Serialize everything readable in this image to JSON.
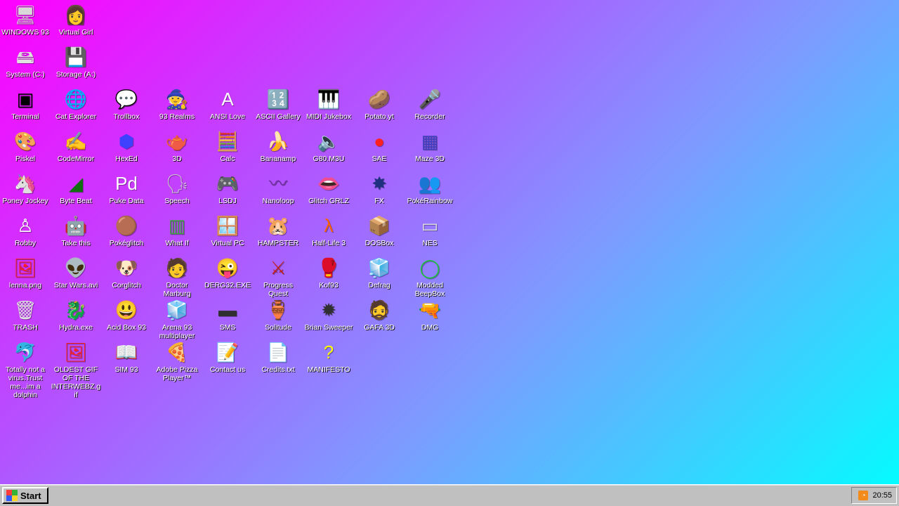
{
  "desktop": {
    "icons": [
      {
        "label": "WINDOWS 93",
        "name": "windows93",
        "glyph": "🖥",
        "color": "#d8d8d8"
      },
      {
        "label": "Virtual Girl",
        "name": "virtual-girl",
        "glyph": "👩",
        "color": "#e0b090"
      },
      {
        "label": "System (C:)",
        "name": "system-c",
        "glyph": "🖴",
        "color": "#e0e0e0"
      },
      {
        "label": "Storage (A:)",
        "name": "storage-a",
        "glyph": "💾",
        "color": "#d0d0d0"
      },
      {
        "label": "Terminal",
        "name": "terminal",
        "glyph": "▣",
        "color": "#000000"
      },
      {
        "label": "Cat Explorer",
        "name": "cat-explorer",
        "glyph": "🌐",
        "color": "#3c9cff"
      },
      {
        "label": "Trollbox",
        "name": "trollbox",
        "glyph": "💬",
        "color": "#4cc9ff"
      },
      {
        "label": "93 Realms",
        "name": "93-realms",
        "glyph": "🧙",
        "color": "#ff2020"
      },
      {
        "label": "ANSI Love",
        "name": "ansi-love",
        "glyph": "A",
        "color": "#ffffff"
      },
      {
        "label": "ASCII Gallery",
        "name": "ascii-gallery",
        "glyph": "🔢",
        "color": "#00b0b0"
      },
      {
        "label": "MIDI Jukebox",
        "name": "midi-jukebox",
        "glyph": "🎹",
        "color": "#222222"
      },
      {
        "label": "Potato.yt",
        "name": "potato-yt",
        "glyph": "🥔",
        "color": "#c08040"
      },
      {
        "label": "Recorder",
        "name": "recorder",
        "glyph": "🎤",
        "color": "#888888"
      },
      {
        "label": "Piskel",
        "name": "piskel",
        "glyph": "🎨",
        "color": "#e0b020"
      },
      {
        "label": "CodeMirror",
        "name": "codemirror",
        "glyph": "✍",
        "color": "#ffffff"
      },
      {
        "label": "HexEd",
        "name": "hexed",
        "glyph": "⬢",
        "color": "#4040ff"
      },
      {
        "label": "3D",
        "name": "3d",
        "glyph": "🫖",
        "color": "#ff9ec4"
      },
      {
        "label": "Calc",
        "name": "calc",
        "glyph": "🧮",
        "color": "#2a7ad8"
      },
      {
        "label": "Bananamp",
        "name": "bananamp",
        "glyph": "🍌",
        "color": "#ffe000"
      },
      {
        "label": "G80.M3U",
        "name": "g80-m3u",
        "glyph": "🔈",
        "color": "#ffffff"
      },
      {
        "label": "SAE",
        "name": "sae",
        "glyph": "●",
        "color": "#ff2020"
      },
      {
        "label": "Maze 3D",
        "name": "maze-3d",
        "glyph": "▦",
        "color": "#4040c0"
      },
      {
        "label": "Poney Jockey",
        "name": "poney-jockey",
        "glyph": "🦄",
        "color": "#c080ff"
      },
      {
        "label": "Byte Beat",
        "name": "byte-beat",
        "glyph": "◢",
        "color": "#107010"
      },
      {
        "label": "Puke Data",
        "name": "puke-data",
        "glyph": "Pd",
        "color": "#ffffff"
      },
      {
        "label": "Speech",
        "name": "speech",
        "glyph": "🗣",
        "color": "#d0d0d0"
      },
      {
        "label": "LSDJ",
        "name": "lsdj",
        "glyph": "🎮",
        "color": "#ff40ff"
      },
      {
        "label": "Nanoloop",
        "name": "nanoloop",
        "glyph": "〰",
        "color": "#7030a0"
      },
      {
        "label": "Glitch GRLZ",
        "name": "glitch-grlz",
        "glyph": "👄",
        "color": "#ff2050"
      },
      {
        "label": "FX",
        "name": "fx",
        "glyph": "✸",
        "color": "#203080"
      },
      {
        "label": "PokéRainbow",
        "name": "pokerainbow",
        "glyph": "👥",
        "color": "#604020"
      },
      {
        "label": "Robby",
        "name": "robby",
        "glyph": "♙",
        "color": "#ffffff"
      },
      {
        "label": "Take this",
        "name": "take-this",
        "glyph": "🤖",
        "color": "#ff6020"
      },
      {
        "label": "Pokéglitch",
        "name": "pokeglitch",
        "glyph": "🟤",
        "color": "#a06030"
      },
      {
        "label": "What If",
        "name": "what-if",
        "glyph": "▥",
        "color": "#40a040"
      },
      {
        "label": "Virtual PC",
        "name": "virtual-pc",
        "glyph": "🪟",
        "color": "#2060c0"
      },
      {
        "label": "HAMPSTER",
        "name": "hampster",
        "glyph": "🐹",
        "color": "#ffffff"
      },
      {
        "label": "Half-Life 3",
        "name": "half-life-3",
        "glyph": "λ",
        "color": "#ff6000"
      },
      {
        "label": "DOSBox",
        "name": "dosbox",
        "glyph": "📦",
        "color": "#c0a000"
      },
      {
        "label": "NES",
        "name": "nes",
        "glyph": "▭",
        "color": "#e0e0e0"
      },
      {
        "label": "lenna.png",
        "name": "lenna-png",
        "glyph": "🖼",
        "color": "#ff2020"
      },
      {
        "label": "Star Wars.avi",
        "name": "star-wars-avi",
        "glyph": "👽",
        "color": "#60c040"
      },
      {
        "label": "Corglitch",
        "name": "corglitch",
        "glyph": "🐶",
        "color": "#d08030"
      },
      {
        "label": "Doctor Marburg",
        "name": "doctor-marburg",
        "glyph": "🧑",
        "color": "#e0c0a0"
      },
      {
        "label": "DERG32.EXE",
        "name": "derg32-exe",
        "glyph": "😜",
        "color": "#ffffff"
      },
      {
        "label": "Progress Quest",
        "name": "progress-quest",
        "glyph": "⚔",
        "color": "#c02020"
      },
      {
        "label": "Kof93",
        "name": "kof93",
        "glyph": "🥊",
        "color": "#d0a080"
      },
      {
        "label": "Defrag",
        "name": "defrag",
        "glyph": "🧊",
        "color": "#3080ff"
      },
      {
        "label": "Modded BeepBox",
        "name": "modded-beepbox",
        "glyph": "◯",
        "color": "#20c040"
      },
      {
        "label": "TRASH",
        "name": "trash",
        "glyph": "🗑",
        "color": "#e0e0e0"
      },
      {
        "label": "Hydra.exe",
        "name": "hydra-exe",
        "glyph": "🐉",
        "color": "#208020"
      },
      {
        "label": "Acid Box 93",
        "name": "acid-box-93",
        "glyph": "😃",
        "color": "#ffff00"
      },
      {
        "label": "Arena 93 multiplayer",
        "name": "arena-93-multiplayer",
        "glyph": "🧊",
        "color": "#40c0ff"
      },
      {
        "label": "SMS",
        "name": "sms",
        "glyph": "▬",
        "color": "#303030"
      },
      {
        "label": "Solitude",
        "name": "solitude",
        "glyph": "🏺",
        "color": "#40a0ff"
      },
      {
        "label": "Brian Sweeper",
        "name": "brian-sweeper",
        "glyph": "✹",
        "color": "#303030"
      },
      {
        "label": "GAFA 3D",
        "name": "gafa-3d",
        "glyph": "🧔",
        "color": "#c07030"
      },
      {
        "label": "DMG",
        "name": "dmg",
        "glyph": "🔫",
        "color": "#a0a0a0"
      },
      {
        "label": "Totally not a virus.Trust me...im a dolphin",
        "name": "dolphin",
        "glyph": "🐬",
        "color": "#40a0ff"
      },
      {
        "label": "OLDEST GIF OF THE INTERWEBZ.gif",
        "name": "oldest-gif",
        "glyph": "🖼",
        "color": "#ff2020"
      },
      {
        "label": "SIM 93",
        "name": "sim-93",
        "glyph": "📖",
        "color": "#ffffff"
      },
      {
        "label": "Adobe Pizza Player™",
        "name": "adobe-pizza-player",
        "glyph": "🍕",
        "color": "#e0a040"
      },
      {
        "label": "Contact us",
        "name": "contact-us",
        "glyph": "📝",
        "color": "#ffffff"
      },
      {
        "label": "Credits.txt",
        "name": "credits-txt",
        "glyph": "📄",
        "color": "#ffffff"
      },
      {
        "label": "MANIFESTO",
        "name": "manifesto",
        "glyph": "?",
        "color": "#ffff00"
      }
    ]
  },
  "taskbar": {
    "start_label": "Start",
    "clock": "20:55"
  }
}
